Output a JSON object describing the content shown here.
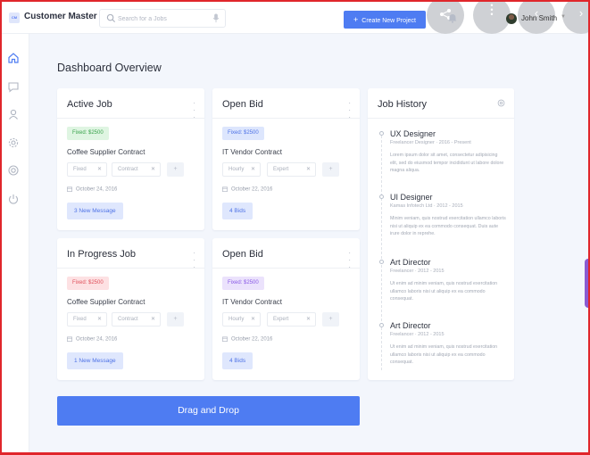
{
  "app": {
    "logo": "CM",
    "title": "Customer Master"
  },
  "search": {
    "placeholder": "Search for a Jobs"
  },
  "header": {
    "create_button": "Create New Project",
    "user_name": "John Smith"
  },
  "sidebar": {
    "items": [
      {
        "icon": "home-icon"
      },
      {
        "icon": "chat-icon"
      },
      {
        "icon": "user-icon"
      },
      {
        "icon": "settings-icon"
      },
      {
        "icon": "gear-icon"
      },
      {
        "icon": "power-icon"
      }
    ]
  },
  "page": {
    "title": "Dashboard Overview"
  },
  "cards": [
    {
      "title": "Active Job",
      "badge": "Fixed: $2500",
      "badge_color": "green",
      "job": "Coffee Supplier Contract",
      "chip1": "Fixed",
      "chip2": "Contract",
      "date": "October 24, 2016",
      "action": "3 New Message"
    },
    {
      "title": "Open Bid",
      "badge": "Fixed: $2500",
      "badge_color": "blue",
      "job": "IT Vendor Contract",
      "chip1": "Hourly",
      "chip2": "Expert",
      "date": "October 22, 2016",
      "action": "4 Bids"
    },
    {
      "title": "In Progress Job",
      "badge": "Fixed: $2500",
      "badge_color": "red",
      "job": "Coffee Supplier Contract",
      "chip1": "Fixed",
      "chip2": "Contract",
      "date": "October 24, 2016",
      "action": "1 New Message"
    },
    {
      "title": "Open Bid",
      "badge": "Fixed: $2500",
      "badge_color": "purple",
      "job": "IT Vendor Contract",
      "chip1": "Hourly",
      "chip2": "Expert",
      "date": "October 22, 2016",
      "action": "4 Bids"
    }
  ],
  "history": {
    "title": "Job History",
    "items": [
      {
        "role": "UX Designer",
        "meta": "Freelancer Designer  ·  2016 - Present",
        "desc": "Lorem ipsum dolor sit amet, consectetur adipisicing elit, sed do eiusmod tempor incididunt ut labore dolore magna aliqua."
      },
      {
        "role": "UI Designer",
        "meta": "Kamas Infotech Ltd  ·  2012 - 2015",
        "desc": "Minim veniam, quis nostrud exercitation ullamco laboris nisi ut aliquip ex ea commodo consequat. Duis aute irure dolor in reprehe."
      },
      {
        "role": "Art Director",
        "meta": "Freelancer  ·  2012 - 2015",
        "desc": "Ut enim ad minim veniam, quis nostrud exercitation ullamco laboris nisi ut aliquip ex ea commodo consequat."
      },
      {
        "role": "Art Director",
        "meta": "Freelancer  ·  2012 - 2015",
        "desc": "Ut enim ad minim veniam, quis nostrud exercitation ullamco laboris nisi ut aliquip ex ea commodo consequat."
      }
    ]
  },
  "dnd": {
    "label": "Drag and Drop"
  },
  "colors": {
    "accent": "#4e7cf2",
    "frame": "#e0262b",
    "green": "#3aa34c",
    "blue": "#4f73e6",
    "red": "#e0505b",
    "purple": "#8a5ae6"
  }
}
